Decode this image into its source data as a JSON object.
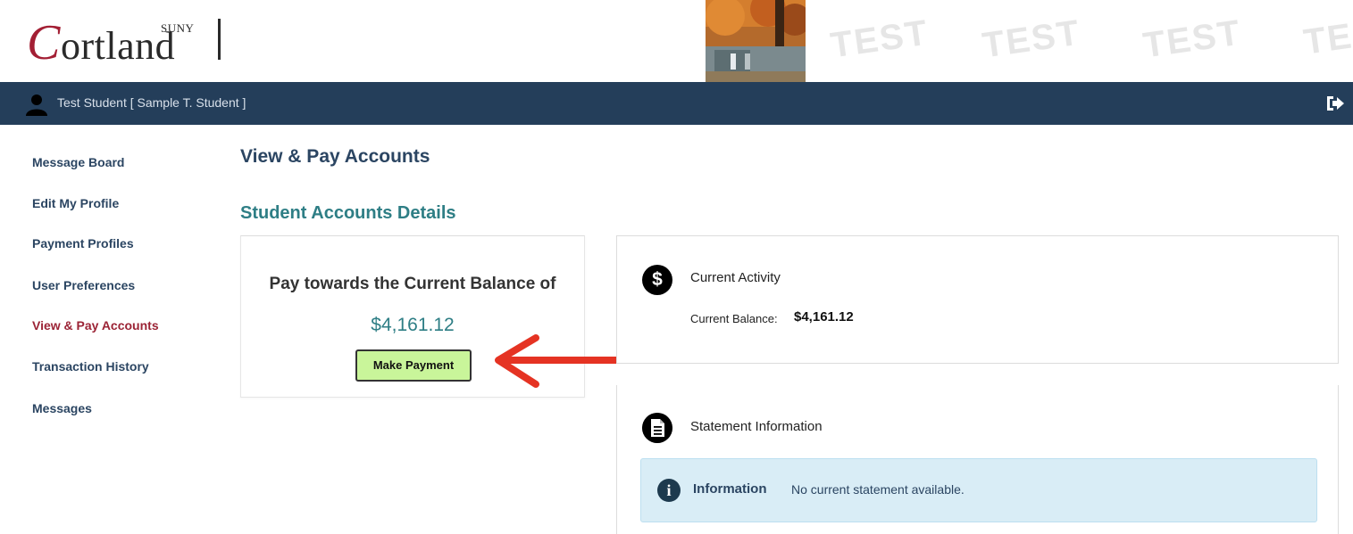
{
  "header": {
    "logo": {
      "letter": "C",
      "word": "ortland",
      "tag": "SUNY"
    },
    "watermark": [
      "TEST",
      "TEST",
      "TEST",
      "TE"
    ]
  },
  "userbar": {
    "user_name": "Test Student [ Sample T. Student ]",
    "user_icon": "user-icon",
    "logout_icon": "logout-icon"
  },
  "sidebar": {
    "items": [
      {
        "label": "Message Board",
        "active": false
      },
      {
        "label": "Edit My Profile",
        "active": false
      },
      {
        "label": "Payment Profiles",
        "active": false
      },
      {
        "label": "User Preferences",
        "active": false
      },
      {
        "label": "View & Pay Accounts",
        "active": true
      },
      {
        "label": "Transaction History",
        "active": false
      },
      {
        "label": "Messages",
        "active": false
      }
    ]
  },
  "main": {
    "page_title": "View & Pay Accounts",
    "section_title": "Student Accounts Details",
    "pay_panel": {
      "label": "Pay towards the Current Balance of",
      "amount": "$4,161.12",
      "button_label": "Make Payment"
    },
    "activity": {
      "icon": "dollar-icon",
      "title": "Current Activity",
      "balance_label": "Current Balance:",
      "balance_value": "$4,161.12"
    },
    "statement": {
      "icon": "document-icon",
      "title": "Statement Information",
      "info_icon": "info-icon",
      "info_label": "Information",
      "info_text": "No current statement available."
    }
  },
  "colors": {
    "userbar_bg": "#243e5a",
    "active_nav": "#9b2335",
    "nav": "#2b4562",
    "accent_teal": "#2e7e85",
    "button_bg": "#c9f59a",
    "arrow": "#e53323",
    "info_bg": "#d9edf6"
  }
}
